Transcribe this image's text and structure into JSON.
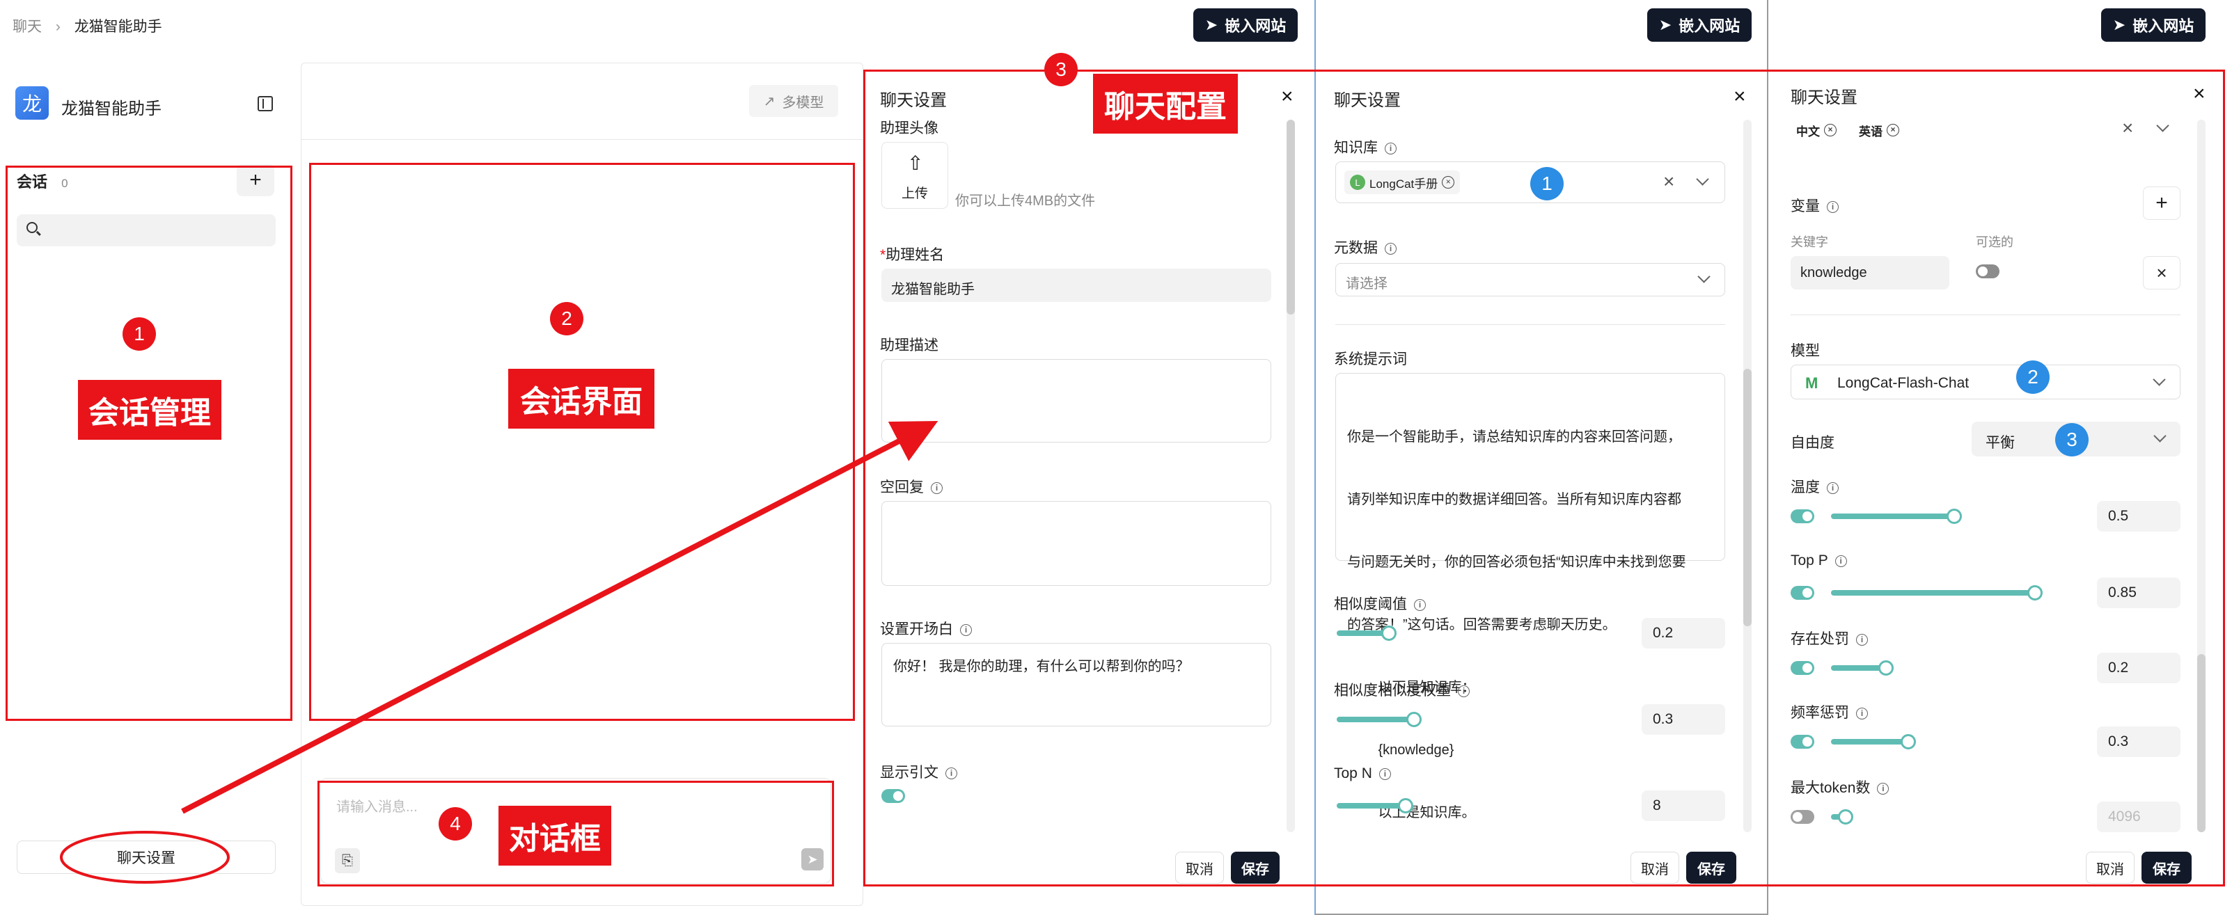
{
  "breadcrumb": {
    "home": "聊天",
    "current": "龙猫智能助手"
  },
  "embed_label": "嵌入网站",
  "sidebar": {
    "avatar_char": "龙",
    "app_name": "龙猫智能助手",
    "sessions_label": "会话",
    "sessions_count": "0",
    "chat_settings_button": "聊天设置"
  },
  "main": {
    "multi_model_label": "多模型"
  },
  "composer": {
    "placeholder": "请输入消息..."
  },
  "panel_settings": {
    "title": "聊天设置",
    "avatar_label": "助理头像",
    "upload_label": "上传",
    "upload_hint": "你可以上传4MB的文件",
    "name_label": "助理姓名",
    "name_required_mark": "*",
    "name_value": "龙猫智能助手",
    "desc_label": "助理描述",
    "empty_reply_label": "空回复",
    "opener_label": "设置开场白",
    "opener_value": "你好！ 我是你的助理，有什么可以帮到你的吗？",
    "show_citation_label": "显示引文",
    "cancel": "取消",
    "save": "保存"
  },
  "panel_kb": {
    "title": "聊天设置",
    "kb_label": "知识库",
    "kb_tag_icon": "L",
    "kb_tag": "LongCat手册",
    "meta_label": "元数据",
    "meta_placeholder": "请选择",
    "prompt_label": "系统提示词",
    "prompt_lines": [
      "你是一个智能助手，请总结知识库的内容来回答问题，",
      "请列举知识库中的数据详细回答。当所有知识库内容都",
      "与问题无关时，你的回答必须包括“知识库中未找到您要",
      "的答案！”这句话。回答需要考虑聊天历史。",
      "        以下是知识库：",
      "        {knowledge}",
      "        以上是知识库。"
    ],
    "sim_threshold_label": "相似度阈值",
    "sim_threshold_value": "0.2",
    "sim_weight_label": "相似度相似度权重",
    "sim_weight_value": "0.3",
    "topn_label": "Top N",
    "topn_value": "8",
    "cancel": "取消",
    "save": "保存"
  },
  "panel_model": {
    "title": "聊天设置",
    "lang_tags": [
      "中文",
      "英语"
    ],
    "var_label": "变量",
    "key_col": "关键字",
    "optional_col": "可选的",
    "var_key_value": "knowledge",
    "model_label": "模型",
    "model_value": "LongCat-Flash-Chat",
    "freedom_label": "自由度",
    "freedom_value": "平衡",
    "temp_label": "温度",
    "temp_value": "0.5",
    "topp_label": "Top P",
    "topp_value": "0.85",
    "presence_label": "存在处罚",
    "presence_value": "0.2",
    "frequency_label": "频率惩罚",
    "frequency_value": "0.3",
    "maxtoken_label": "最大token数",
    "maxtoken_value": "4096",
    "cancel": "取消",
    "save": "保存"
  },
  "annotations": {
    "session_mgmt": "会话管理",
    "session_ui": "会话界面",
    "chat_config": "聊天配置",
    "dialog_box": "对话框",
    "red_numbers": [
      "1",
      "2",
      "3",
      "4"
    ],
    "blue_numbers": [
      "1",
      "2",
      "3"
    ]
  },
  "colors": {
    "accent": "#5fbcb3",
    "dark": "#121a2a",
    "annotation_red": "#e8141a",
    "annotation_blue": "#2b8de3",
    "avatar_blue": "#3b82f6"
  }
}
